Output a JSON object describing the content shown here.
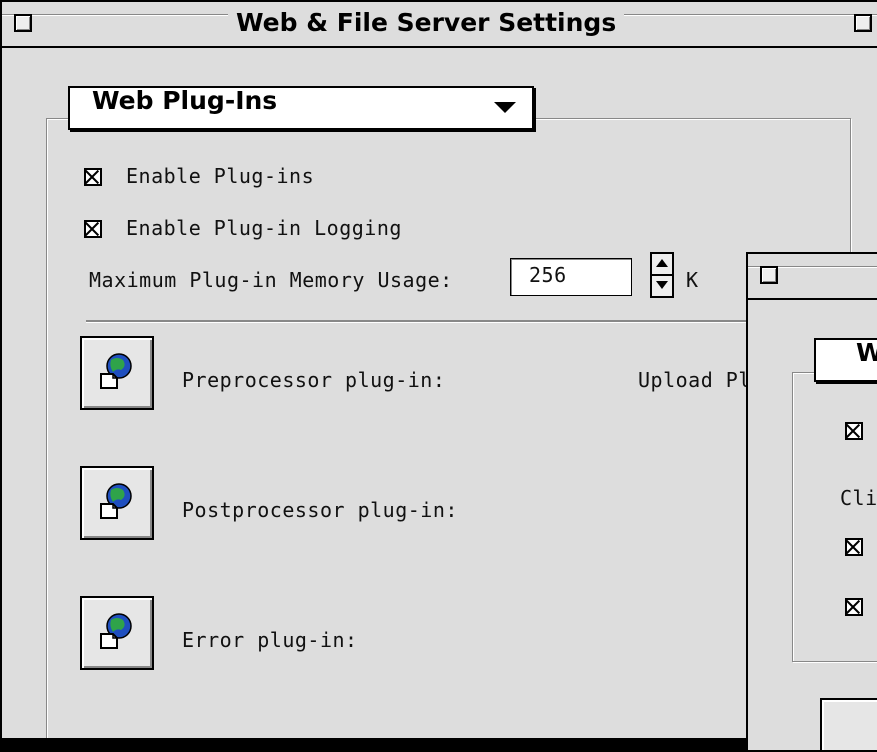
{
  "window": {
    "title": "Web & File Server Settings"
  },
  "popup": {
    "label": "Web Plug-Ins"
  },
  "options": {
    "enable_plugins": {
      "label": "Enable Plug-ins",
      "checked": true
    },
    "enable_logging": {
      "label": "Enable Plug-in Logging",
      "checked": true
    }
  },
  "memory": {
    "label": "Maximum Plug-in Memory Usage:",
    "value": "256",
    "unit": "K"
  },
  "plugins": [
    {
      "label": "Preprocessor plug-in:",
      "icon": "globe-document-icon"
    },
    {
      "label": "Postprocessor plug-in:",
      "icon": "globe-document-icon"
    },
    {
      "label": "Error plug-in:",
      "icon": "globe-document-icon"
    }
  ],
  "clipped_text": {
    "upload": "Upload Pl"
  },
  "back_window": {
    "popup_fragment": "W",
    "cli_fragment": "Cli"
  }
}
